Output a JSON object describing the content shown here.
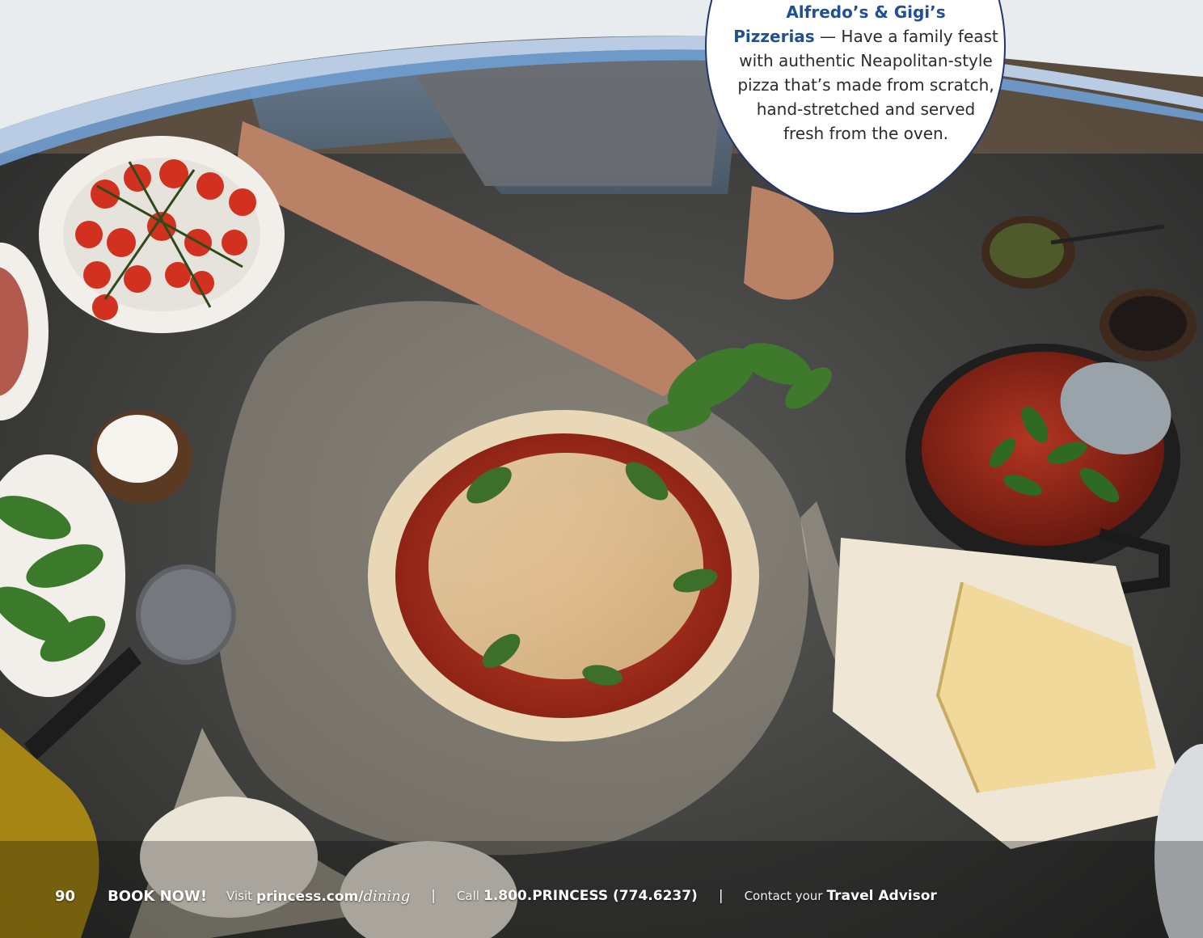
{
  "callout": {
    "title": "Alfredo’s & Gigi’s Pizzerias",
    "title_line1": "Alfredo’s & Gigi’s",
    "title_line2": "Pizzerias",
    "body_line2": " — Have a family feast",
    "body_line3": "with authentic Neapolitan-style",
    "body_line4": "pizza that’s made from scratch,",
    "body_line5": "hand-stretched and served",
    "body_line6": "fresh from the oven."
  },
  "footer": {
    "page_number": "90",
    "book_now": "BOOK NOW!",
    "visit_label": "Visit",
    "visit_url_domain": "princess.com/",
    "visit_url_path": "dining",
    "separator": "|",
    "call_label": "Call",
    "call_number": "1.800.PRINCESS (774.6237)",
    "contact_label": "Contact your",
    "contact_target": "Travel Advisor"
  },
  "colors": {
    "accent_blue": "#1f4f96",
    "border_navy": "#23356b",
    "wave_light": "#dfe6ee",
    "wave_blue": "#6f9fd3"
  }
}
